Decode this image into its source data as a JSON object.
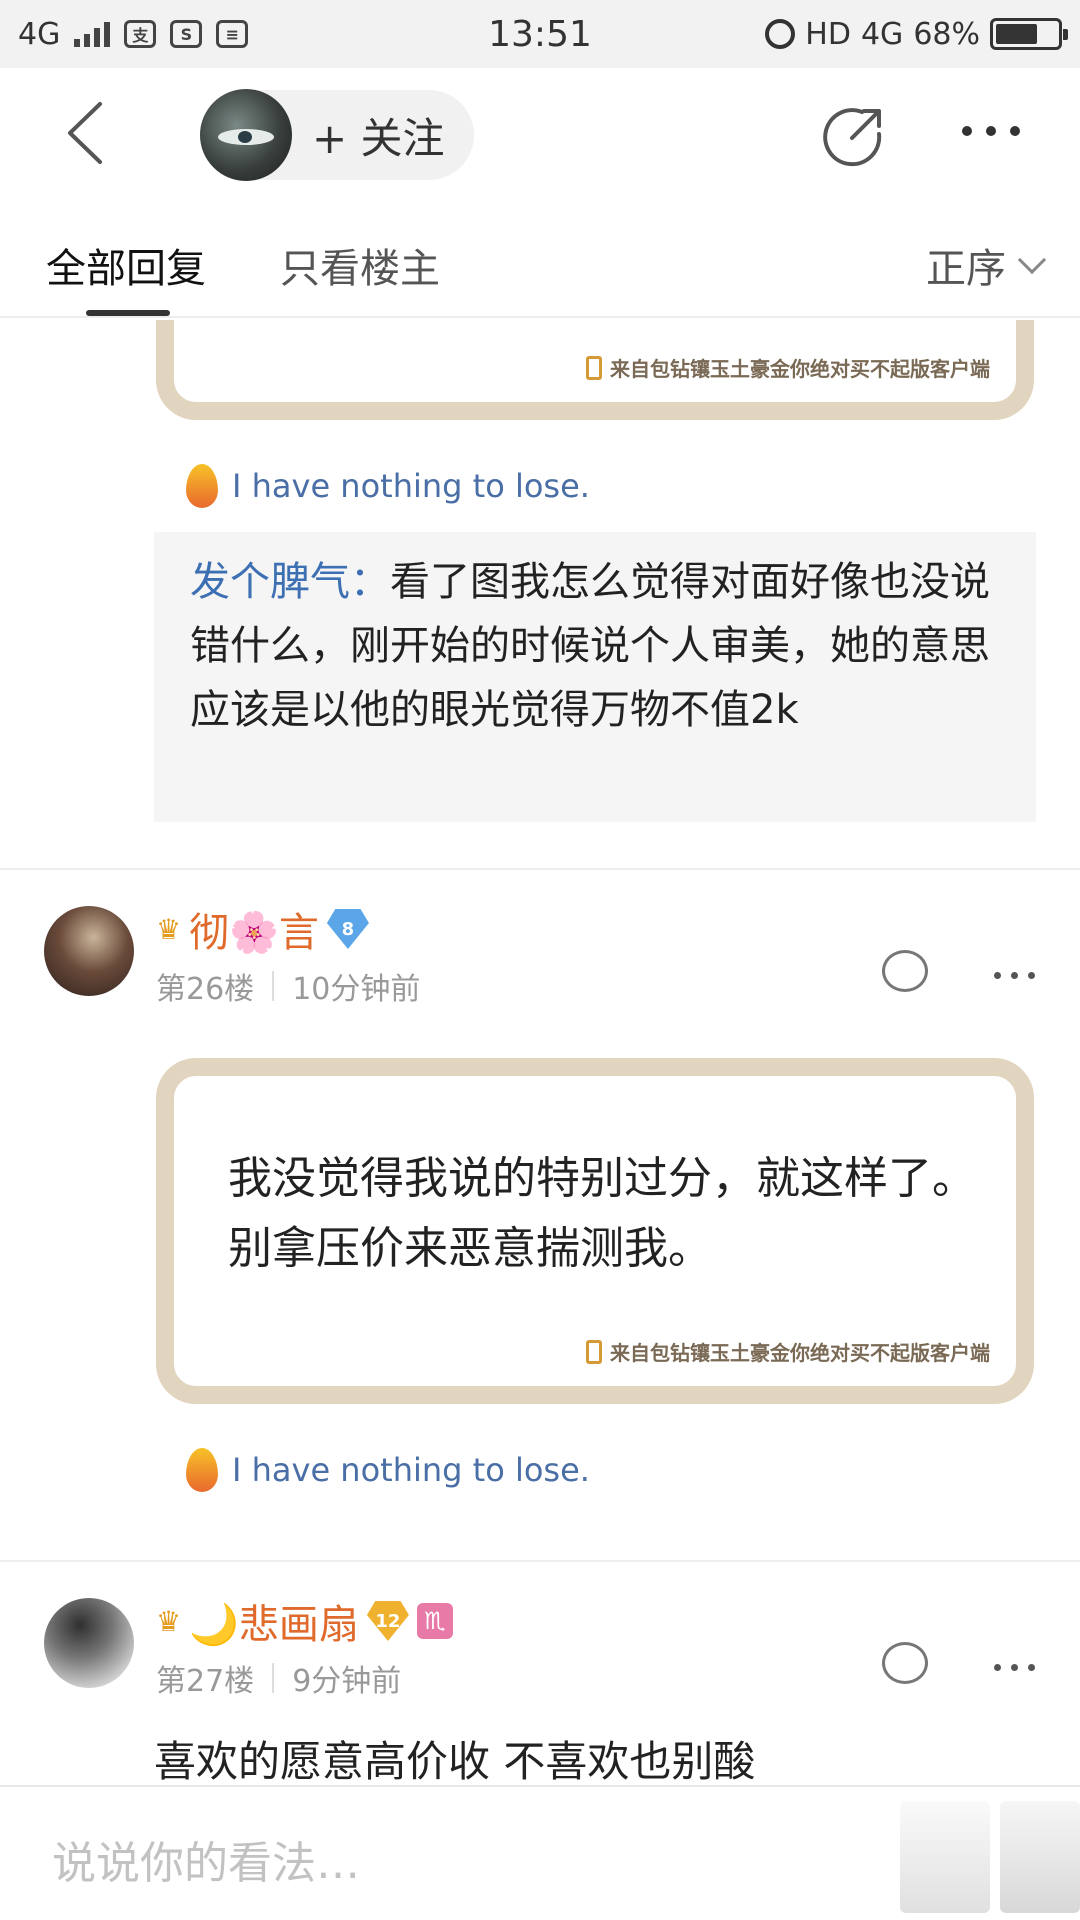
{
  "status_bar": {
    "network_left": "4G",
    "time": "13:51",
    "hd": "HD",
    "network_right": "4G",
    "battery_percent": "68%",
    "battery_level": 0.68
  },
  "top_nav": {
    "follow_label": "+ 关注"
  },
  "tabs": {
    "all_replies": "全部回复",
    "host_only": "只看楼主",
    "sort": "正序"
  },
  "posts": [
    {
      "bubble_source": "来自包钻镶玉土豪金你绝对买不起版客户端",
      "signature": "I have nothing to lose.",
      "quote": {
        "author": "发个脾气：",
        "text": "看了图我怎么觉得对面好像也没说错什么，刚开始的时候说个人审美，她的意思应该是以他的眼光觉得万物不值2k"
      }
    },
    {
      "username": "彻🌸言",
      "level": "8",
      "floor": "第26楼",
      "time": "10分钟前",
      "text": "我没觉得我说的特别过分，就这样了。别拿压价来恶意揣测我。",
      "bubble_source": "来自包钻镶玉土豪金你绝对买不起版客户端",
      "signature": "I have nothing to lose."
    },
    {
      "username": "🌙悲画扇",
      "level": "12",
      "zodiac": "♏",
      "floor": "第27楼",
      "time": "9分钟前",
      "text": "喜欢的愿意高价收 不喜欢也别酸"
    }
  ],
  "bottom_bar": {
    "input_placeholder": "说说你的看法…"
  },
  "colors": {
    "accent_name": "#e06a2b",
    "link_blue": "#3d6fb3",
    "bubble_border": "#e2d5bf"
  }
}
